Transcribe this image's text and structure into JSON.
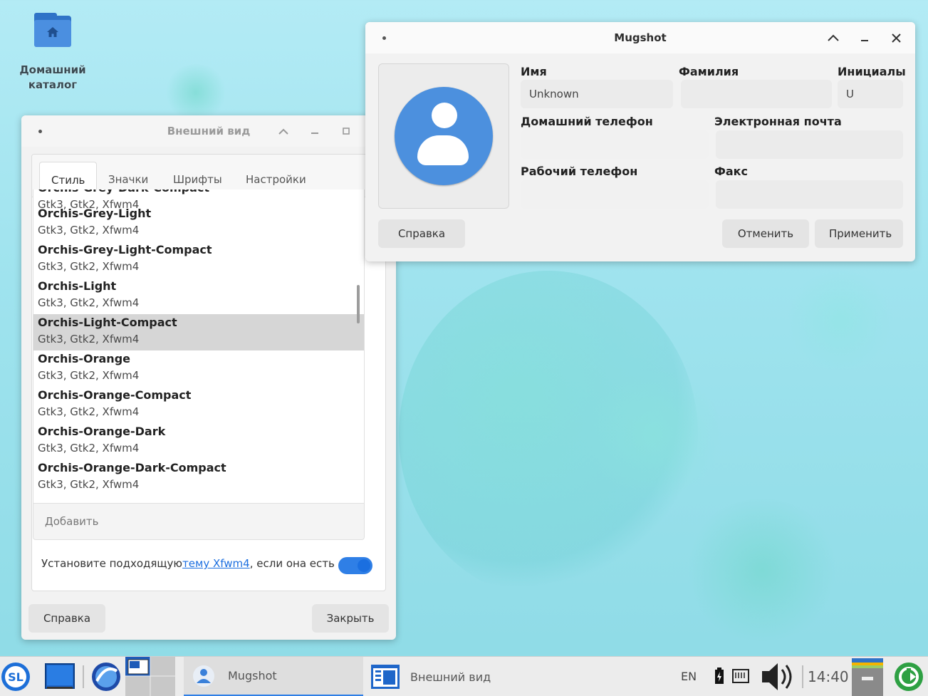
{
  "desktop": {
    "home_icon_label_line1": "Домашний",
    "home_icon_label_line2": "каталог"
  },
  "appearance": {
    "title": "Внешний вид",
    "tabs": [
      "Стиль",
      "Значки",
      "Шрифты",
      "Настройки"
    ],
    "partial_top_name": "Orchis-Grey-Dark-Compact",
    "partial_top_sub": "Gtk3, Gtk2, Xfwm4",
    "themes": [
      {
        "name": "Orchis-Grey-Light",
        "sub": "Gtk3, Gtk2, Xfwm4"
      },
      {
        "name": "Orchis-Grey-Light-Compact",
        "sub": "Gtk3, Gtk2, Xfwm4"
      },
      {
        "name": "Orchis-Light",
        "sub": "Gtk3, Gtk2, Xfwm4"
      },
      {
        "name": "Orchis-Light-Compact",
        "sub": "Gtk3, Gtk2, Xfwm4"
      },
      {
        "name": "Orchis-Orange",
        "sub": "Gtk3, Gtk2, Xfwm4"
      },
      {
        "name": "Orchis-Orange-Compact",
        "sub": "Gtk3, Gtk2, Xfwm4"
      },
      {
        "name": "Orchis-Orange-Dark",
        "sub": "Gtk3, Gtk2, Xfwm4"
      },
      {
        "name": "Orchis-Orange-Dark-Compact",
        "sub": "Gtk3, Gtk2, Xfwm4"
      }
    ],
    "selected_theme": "Orchis-Light-Compact",
    "add_label": "Добавить",
    "xfwm_text_before": "Установите подходящую",
    "xfwm_link": "тему Xfwm4",
    "xfwm_text_after": ", если она есть",
    "help_button": "Справка",
    "close_button": "Закрыть"
  },
  "mugshot": {
    "title": "Mugshot",
    "labels": {
      "first_name": "Имя",
      "last_name": "Фамилия",
      "initials": "Инициалы",
      "home_phone": "Домашний телефон",
      "email": "Электронная почта",
      "work_phone": "Рабочий телефон",
      "fax": "Факс"
    },
    "values": {
      "first_name": "Unknown",
      "last_name": "",
      "initials": "U",
      "home_phone": "",
      "email": "",
      "work_phone": "",
      "fax": ""
    },
    "help_button": "Справка",
    "cancel_button": "Отменить",
    "apply_button": "Применить"
  },
  "taskbar": {
    "tasks": [
      {
        "label": "Mugshot"
      },
      {
        "label": "Внешний вид"
      }
    ],
    "keyboard_layout": "EN",
    "clock": "14:40"
  },
  "colors": {
    "accent": "#2f7fe6",
    "link": "#1c6fe0",
    "avatar": "#4c90de",
    "selection": "#d6d6d6"
  }
}
